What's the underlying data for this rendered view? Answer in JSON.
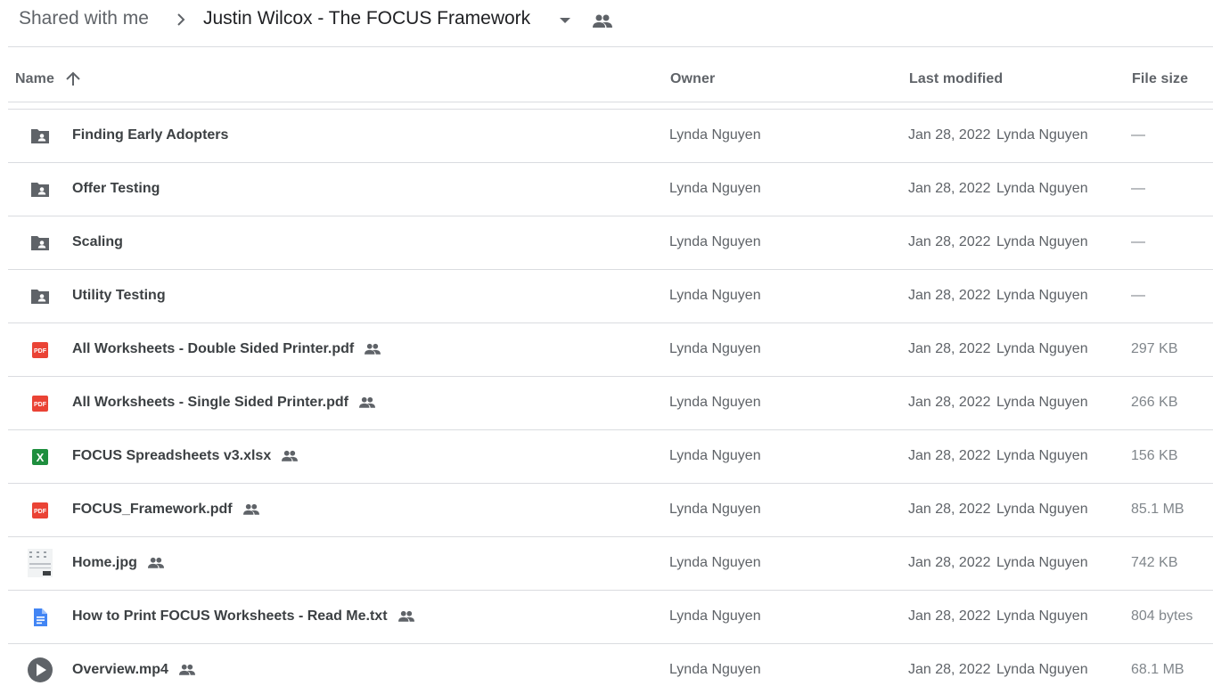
{
  "breadcrumb": {
    "root": "Shared with me",
    "current": "Justin Wilcox - The FOCUS Framework"
  },
  "columns": {
    "name": "Name",
    "owner": "Owner",
    "last_modified": "Last modified",
    "file_size": "File size"
  },
  "files": [
    {
      "name": "Finding Early Adopters",
      "type": "shared-folder",
      "shared": false,
      "owner": "Lynda Nguyen",
      "modified_date": "Jan 28, 2022",
      "modified_by": "Lynda Nguyen",
      "size": "—"
    },
    {
      "name": "Offer Testing",
      "type": "shared-folder",
      "shared": false,
      "owner": "Lynda Nguyen",
      "modified_date": "Jan 28, 2022",
      "modified_by": "Lynda Nguyen",
      "size": "—"
    },
    {
      "name": "Scaling",
      "type": "shared-folder",
      "shared": false,
      "owner": "Lynda Nguyen",
      "modified_date": "Jan 28, 2022",
      "modified_by": "Lynda Nguyen",
      "size": "—"
    },
    {
      "name": "Utility Testing",
      "type": "shared-folder",
      "shared": false,
      "owner": "Lynda Nguyen",
      "modified_date": "Jan 28, 2022",
      "modified_by": "Lynda Nguyen",
      "size": "—"
    },
    {
      "name": "All Worksheets - Double Sided Printer.pdf",
      "type": "pdf",
      "shared": true,
      "owner": "Lynda Nguyen",
      "modified_date": "Jan 28, 2022",
      "modified_by": "Lynda Nguyen",
      "size": "297 KB"
    },
    {
      "name": "All Worksheets - Single Sided Printer.pdf",
      "type": "pdf",
      "shared": true,
      "owner": "Lynda Nguyen",
      "modified_date": "Jan 28, 2022",
      "modified_by": "Lynda Nguyen",
      "size": "266 KB"
    },
    {
      "name": "FOCUS Spreadsheets v3.xlsx",
      "type": "xlsx",
      "shared": true,
      "owner": "Lynda Nguyen",
      "modified_date": "Jan 28, 2022",
      "modified_by": "Lynda Nguyen",
      "size": "156 KB"
    },
    {
      "name": "FOCUS_Framework.pdf",
      "type": "pdf",
      "shared": true,
      "owner": "Lynda Nguyen",
      "modified_date": "Jan 28, 2022",
      "modified_by": "Lynda Nguyen",
      "size": "85.1 MB"
    },
    {
      "name": "Home.jpg",
      "type": "image",
      "shared": true,
      "owner": "Lynda Nguyen",
      "modified_date": "Jan 28, 2022",
      "modified_by": "Lynda Nguyen",
      "size": "742 KB"
    },
    {
      "name": "How to Print FOCUS Worksheets - Read Me.txt",
      "type": "doc",
      "shared": true,
      "owner": "Lynda Nguyen",
      "modified_date": "Jan 28, 2022",
      "modified_by": "Lynda Nguyen",
      "size": "804 bytes"
    },
    {
      "name": "Overview.mp4",
      "type": "video",
      "shared": true,
      "owner": "Lynda Nguyen",
      "modified_date": "Jan 28, 2022",
      "modified_by": "Lynda Nguyen",
      "size": "68.1 MB"
    }
  ],
  "icons": {
    "pdf_label": "PDF",
    "xlsx_label": "X",
    "colors": {
      "folder": "#5f6368",
      "pdf": "#ea4335",
      "xlsx": "#1e8e3e",
      "doc": "#4285f4",
      "video": "#5f6368"
    }
  }
}
